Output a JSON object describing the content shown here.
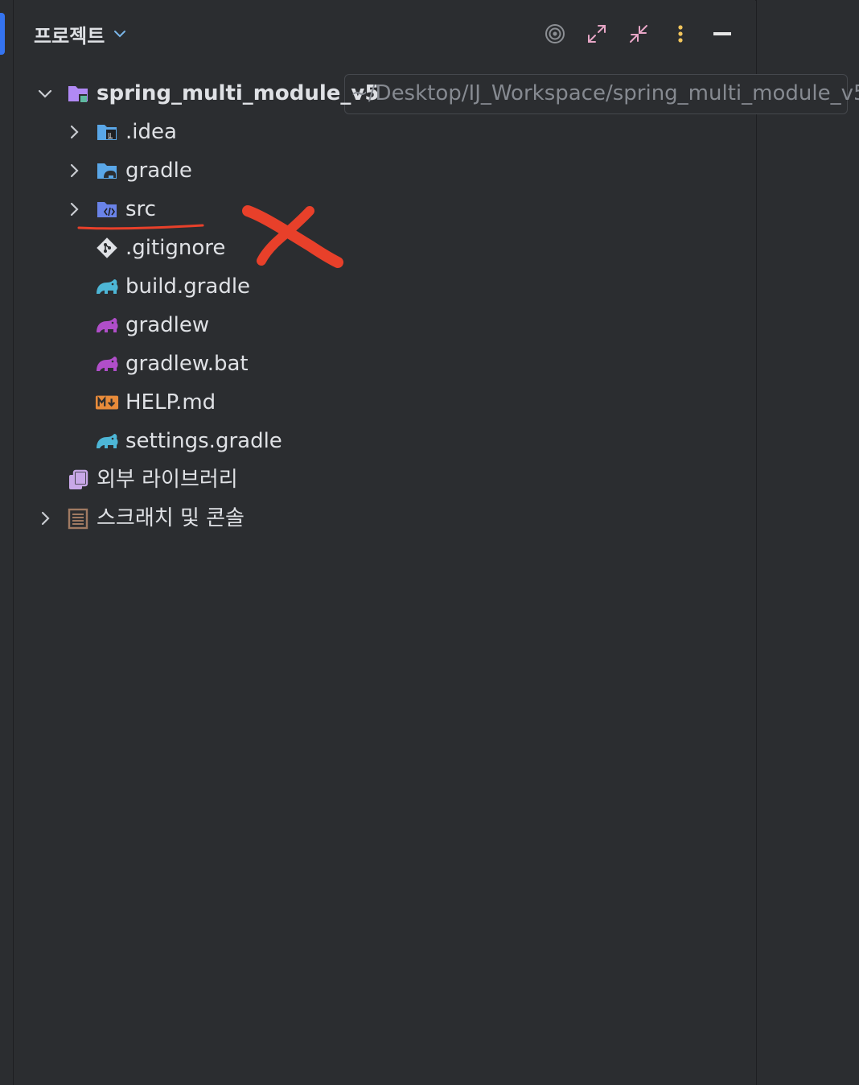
{
  "header": {
    "title": "프로젝트"
  },
  "toolbar": {
    "icons": [
      "target-icon",
      "expand-icon",
      "collapse-icon",
      "more-vertical-icon",
      "minimize-icon"
    ]
  },
  "tree": {
    "root": {
      "name": "spring_multi_module_v5",
      "path": "~/Desktop/IJ_Workspace/spring_multi_module_v5",
      "expanded": true
    },
    "children": [
      {
        "name": ".idea",
        "icon": "idea-folder-icon",
        "expandable": true
      },
      {
        "name": "gradle",
        "icon": "gradle-folder-icon",
        "expandable": true
      },
      {
        "name": "src",
        "icon": "source-folder-icon",
        "expandable": true
      },
      {
        "name": ".gitignore",
        "icon": "git-icon",
        "expandable": false
      },
      {
        "name": "build.gradle",
        "icon": "gradle-elephant-icon",
        "expandable": false
      },
      {
        "name": "gradlew",
        "icon": "gradle-elephant-purple-icon",
        "expandable": false
      },
      {
        "name": "gradlew.bat",
        "icon": "gradle-elephant-purple-icon",
        "expandable": false
      },
      {
        "name": "HELP.md",
        "icon": "markdown-icon",
        "expandable": false
      },
      {
        "name": "settings.gradle",
        "icon": "gradle-elephant-icon",
        "expandable": false
      }
    ],
    "external_libraries": {
      "name": "외부 라이브러리",
      "icon": "library-icon"
    },
    "scratches": {
      "name": "스크래치 및 콘솔",
      "icon": "scratches-icon",
      "expandable": true
    }
  },
  "colors": {
    "background": "#2b2d30",
    "text": "#dfe1e5",
    "muted": "#868a91",
    "accent": "#3574f0",
    "annotation": "#e8402a"
  }
}
